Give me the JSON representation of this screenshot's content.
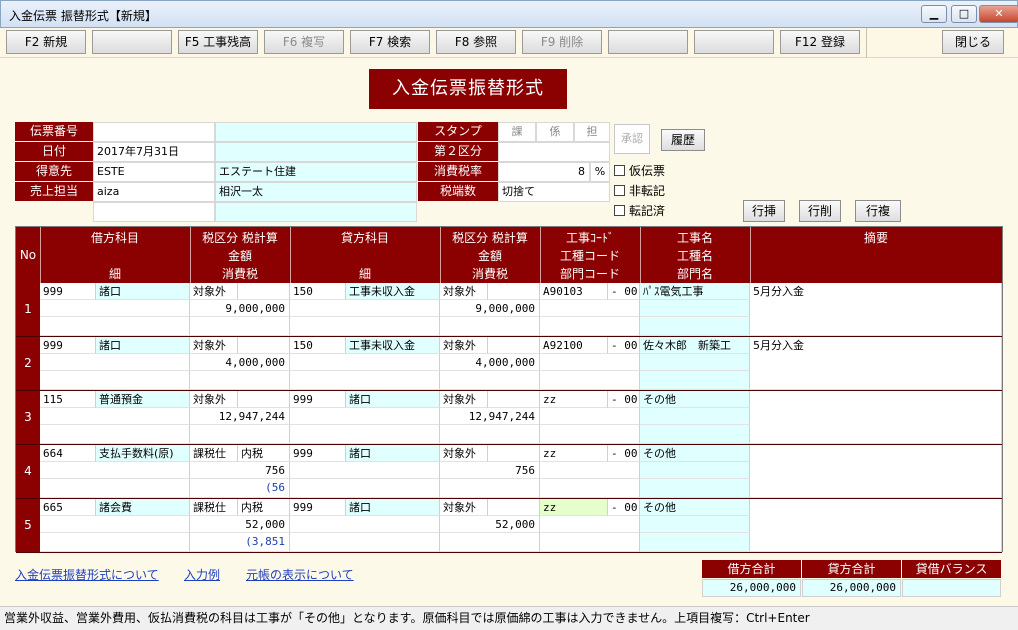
{
  "window": {
    "title": "入金伝票 振替形式【新規】",
    "minimize": "▁",
    "maximize": "□",
    "close": "✕"
  },
  "toolbar": {
    "f2": "F2 新規",
    "f3": "",
    "f5": "F5 工事残高",
    "f6": "F6 複写",
    "f7": "F7 検索",
    "f8": "F8 参照",
    "f9": "F9 削除",
    "f10": "",
    "f11": "",
    "f12": "F12 登録",
    "close": "閉じる"
  },
  "form_title": "入金伝票振替形式",
  "header": {
    "labels": {
      "slip_no": "伝票番号",
      "date": "日付",
      "customer": "得意先",
      "sales_rep": "売上担当",
      "stamp": "スタンプ",
      "second_div": "第２区分",
      "tax_rate": "消費税率",
      "rounding": "税端数"
    },
    "stamp_cols": [
      "課",
      "係",
      "担"
    ],
    "date": "2017年7月31日",
    "customer_code": "ESTE",
    "customer_name": "エステート住建",
    "sales_rep_code": "aiza",
    "sales_rep_name": "相沢一太",
    "tax_rate": "8",
    "tax_rate_unit": "%",
    "rounding": "切捨て",
    "approval": "承認",
    "history_button": "履歴",
    "checks": {
      "provisional": "仮伝票",
      "non_posting": "非転記",
      "posted": "転記済"
    },
    "row_buttons": {
      "insert": "行挿",
      "delete": "行削",
      "copy": "行複"
    }
  },
  "grid": {
    "headers": {
      "no": "No",
      "debit_account": "借方科目",
      "debit_sub": "細",
      "tax_div_calc": "税区分 税計算",
      "amount": "金額",
      "tax": "消費税",
      "credit_account": "貸方科目",
      "credit_sub": "細",
      "tax_div_calc2": "税区分 税計算",
      "amount2": "金額",
      "tax2": "消費税",
      "job_code": "工事ｺｰﾄﾞ",
      "job_type_code": "工種コード",
      "dept_code": "部門コード",
      "job_name": "工事名",
      "job_type_name": "工種名",
      "dept_name": "部門名",
      "memo": "摘要"
    },
    "rows": [
      {
        "no": "1",
        "d_code": "999",
        "d_name": "諸口",
        "d_taxdiv": "対象外",
        "d_taxcalc": "",
        "d_amount": "9,000,000",
        "d_tax": "",
        "c_code": "150",
        "c_name": "工事未収入金",
        "c_taxdiv": "対象外",
        "c_amount": "9,000,000",
        "job_code": "A90103",
        "job_suffix": "- 00",
        "job_name": "ﾊﾟｽ電気工事",
        "memo": "5月分入金"
      },
      {
        "no": "2",
        "d_code": "999",
        "d_name": "諸口",
        "d_taxdiv": "対象外",
        "d_taxcalc": "",
        "d_amount": "4,000,000",
        "d_tax": "",
        "c_code": "150",
        "c_name": "工事未収入金",
        "c_taxdiv": "対象外",
        "c_amount": "4,000,000",
        "job_code": "A92100",
        "job_suffix": "- 00",
        "job_name": "佐々木郎　新築工",
        "memo": "5月分入金"
      },
      {
        "no": "3",
        "d_code": "115",
        "d_name": "普通預金",
        "d_taxdiv": "対象外",
        "d_taxcalc": "",
        "d_amount": "12,947,244",
        "d_tax": "",
        "c_code": "999",
        "c_name": "諸口",
        "c_taxdiv": "対象外",
        "c_amount": "12,947,244",
        "job_code": "zz",
        "job_suffix": "- 00",
        "job_name": "その他",
        "memo": ""
      },
      {
        "no": "4",
        "d_code": "664",
        "d_name": "支払手数料(原)",
        "d_taxdiv": "課税仕",
        "d_taxcalc": "内税",
        "d_amount": "756",
        "d_tax": "(56",
        "c_code": "999",
        "c_name": "諸口",
        "c_taxdiv": "対象外",
        "c_amount": "756",
        "job_code": "zz",
        "job_suffix": "- 00",
        "job_name": "その他",
        "memo": ""
      },
      {
        "no": "5",
        "d_code": "665",
        "d_name": "諸会費",
        "d_taxdiv": "課税仕",
        "d_taxcalc": "内税",
        "d_amount": "52,000",
        "d_tax": "(3,851",
        "c_code": "999",
        "c_name": "諸口",
        "c_taxdiv": "対象外",
        "c_amount": "52,000",
        "job_code": "zz",
        "job_suffix": "- 00",
        "job_name": "その他",
        "memo": ""
      }
    ]
  },
  "links": {
    "about": "入金伝票振替形式について",
    "example": "入力例",
    "ledger": "元帳の表示について"
  },
  "totals": {
    "debit_label": "借方合計",
    "credit_label": "貸方合計",
    "balance_label": "貸借バランス",
    "debit": "26,000,000",
    "credit": "26,000,000",
    "balance": ""
  },
  "status": "営業外収益、営業外費用、仮払消費税の科目は工事が「その他」となります。原価科目では原価綿の工事は入力できません。上項目複写：Ctrl+Enter",
  "colors": {
    "header_red": "#8b0000",
    "cyan": "#e0ffff",
    "link_blue": "#1f3fbf"
  }
}
